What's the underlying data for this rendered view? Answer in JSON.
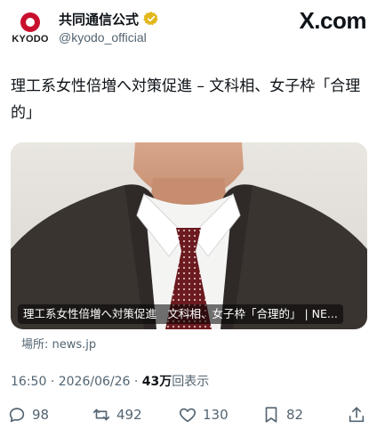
{
  "account": {
    "logo_text": "KYODO",
    "display_name": "共同通信公式",
    "handle": "@kyodo_official"
  },
  "brand": "X.com",
  "tweet": {
    "text": "理工系女性倍増へ対策促進 – 文科相、女子枠「合理的」"
  },
  "card": {
    "caption": "理工系女性倍増へ対策促進　文科相、女子枠「合理的」 | NE...",
    "source": "場所: news.jp"
  },
  "meta": {
    "time": "16:50",
    "date": "2026/06/26",
    "separator": "·",
    "views_count": "43万",
    "views_label": "回表示"
  },
  "actions": {
    "replies": "98",
    "reposts": "492",
    "likes": "130",
    "bookmarks": "82"
  },
  "colors": {
    "verified_badge": "#e2b719",
    "logo_red": "#c8102e",
    "secondary_text": "#536471"
  }
}
